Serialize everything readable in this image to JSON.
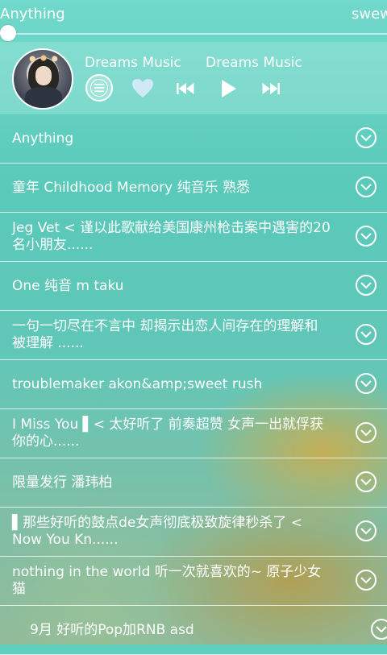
{
  "header": {
    "title": "Anything",
    "right_text": "swew"
  },
  "player": {
    "song": "Dreams Music",
    "artist": "Dreams Music",
    "progress": 0.0,
    "icons": {
      "playlist": "playlist-icon",
      "favorite": "heart-icon",
      "previous": "previous-icon",
      "play": "play-icon",
      "next": "next-icon"
    },
    "accent_color": "#ffffff",
    "favorite_color": "#cde9f5"
  },
  "playlists": [
    {
      "title": "Anything"
    },
    {
      "title": "童年 Childhood Memory 纯音乐 熟悉"
    },
    {
      "title": "Jeg Vet < 谨以此歌献给美国康州枪击案中遇害的20名小朋友......"
    },
    {
      "title": "One 纯音 m taku"
    },
    {
      "title": "一句一切尽在不言中 却揭示出恋人间存在的理解和被理解 ......"
    },
    {
      "title": "troublemaker akon&amp;sweet rush"
    },
    {
      "title": "I Miss You ▌< 太好听了 前奏超赞 女声一出就俘获你的心......"
    },
    {
      "title": "限量发行 潘玮柏"
    },
    {
      "title": "▌那些好听的鼓点de女声彻底极致旋律秒杀了 < Now You Kn......"
    },
    {
      "title": "nothing in the world 听一次就喜欢的~ 原子少女猫"
    },
    {
      "title": "9月 好听的Pop加RNB asd"
    }
  ]
}
